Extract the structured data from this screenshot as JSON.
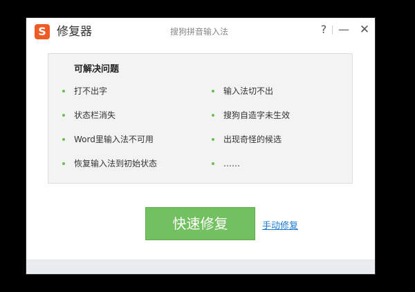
{
  "window": {
    "logo_glyph": "S",
    "title": "修复器",
    "subtitle": "搜狗拼音输入法",
    "help_glyph": "?",
    "minimize_glyph": "—",
    "close_glyph": "✕"
  },
  "panel": {
    "heading": "可解决问题",
    "left_items": [
      {
        "label": "打不出字"
      },
      {
        "label": "状态栏消失"
      },
      {
        "label": "Word里输入法不可用"
      },
      {
        "label": "恢复输入法到初始状态"
      }
    ],
    "right_items": [
      {
        "label": "输入法切不出"
      },
      {
        "label": "搜狗自造字未生效"
      },
      {
        "label": "出现奇怪的候选"
      },
      {
        "label": "……"
      }
    ]
  },
  "actions": {
    "quick_fix_label": "快速修复",
    "manual_fix_label": "手动修复"
  },
  "colors": {
    "brand": "#f05a24",
    "bullet": "#6abf4b",
    "primary_button": "#73c060",
    "link": "#1a7bd4",
    "panel_bg": "#f3f3f3"
  },
  "icons": {
    "logo": "sogou-logo-icon",
    "help": "help-icon",
    "minimize": "minimize-icon",
    "close": "close-icon",
    "bullet": "bullet-dot-icon"
  }
}
